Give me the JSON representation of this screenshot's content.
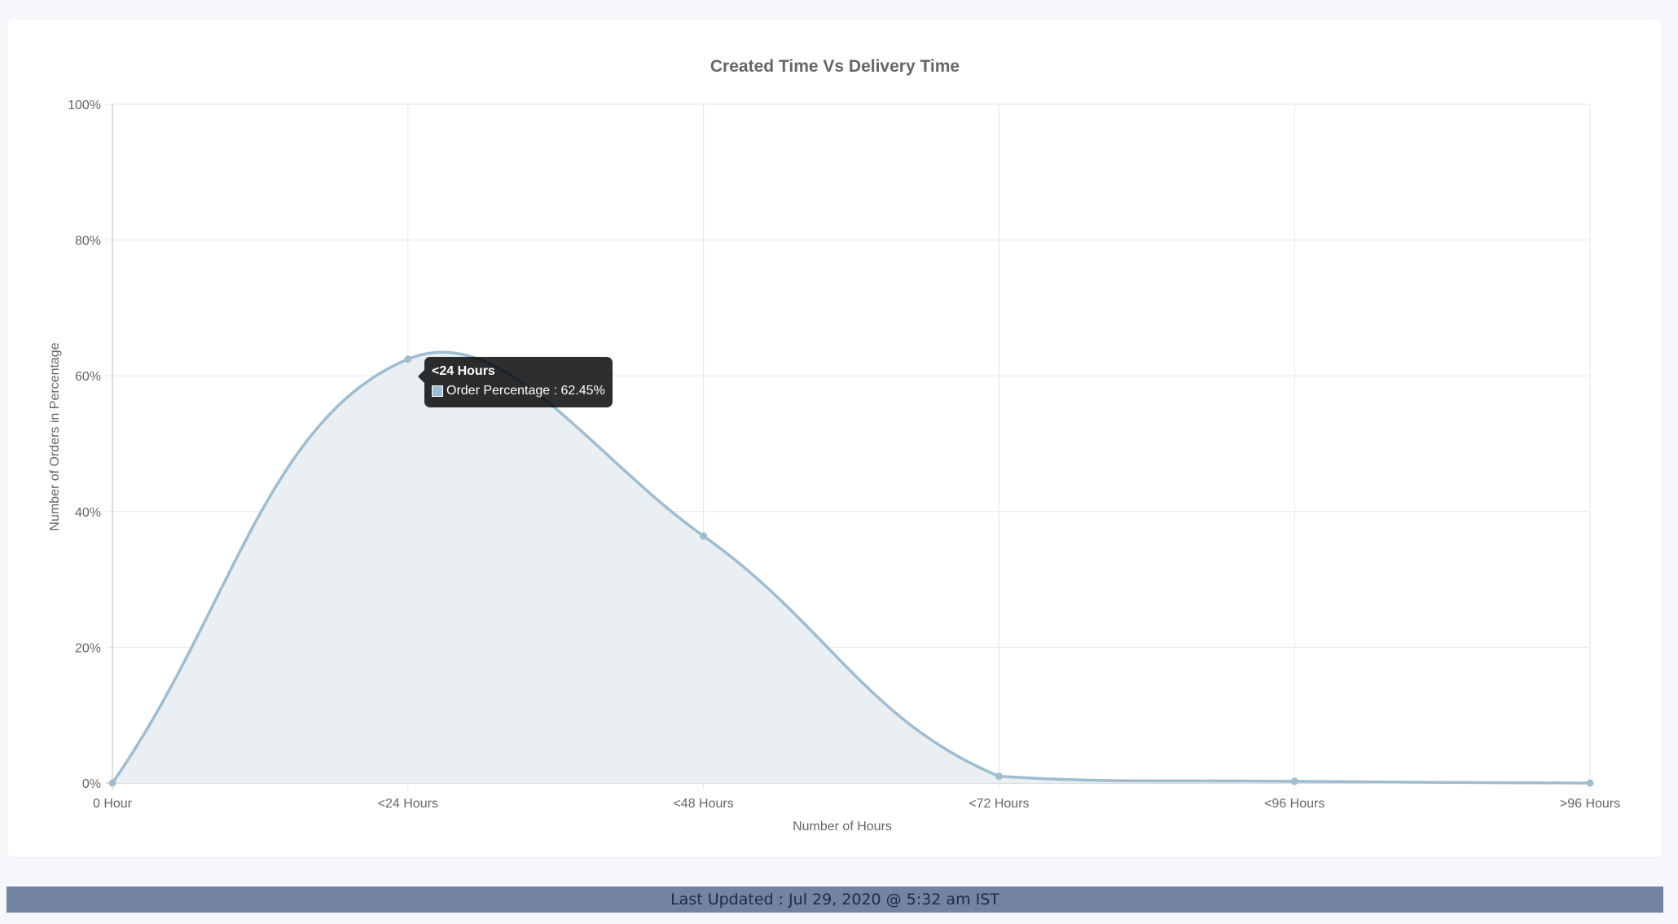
{
  "chart_data": {
    "type": "area",
    "title": "Created Time Vs Delivery Time",
    "xlabel": "Number of Hours",
    "ylabel": "Number of Orders in Percentage",
    "categories": [
      "0 Hour",
      "<24 Hours",
      "<48 Hours",
      "<72 Hours",
      "<96 Hours",
      ">96 Hours"
    ],
    "series": [
      {
        "name": "Order Percentage",
        "values": [
          0,
          62.45,
          36.4,
          1.0,
          0.25,
          0
        ]
      }
    ],
    "ylim": [
      0,
      100
    ],
    "yticks": [
      0,
      20,
      40,
      60,
      80,
      100
    ],
    "ytick_labels": [
      "0%",
      "20%",
      "40%",
      "60%",
      "80%",
      "100%"
    ],
    "grid": true,
    "line_color": "#9fbcd0",
    "fill_color": "#eaeff3"
  },
  "tooltip": {
    "title": "<24 Hours",
    "label": "Order Percentage : 62.45%"
  },
  "footer": {
    "last_updated": "Last Updated : Jul 29, 2020 @ 5:32 am IST"
  }
}
